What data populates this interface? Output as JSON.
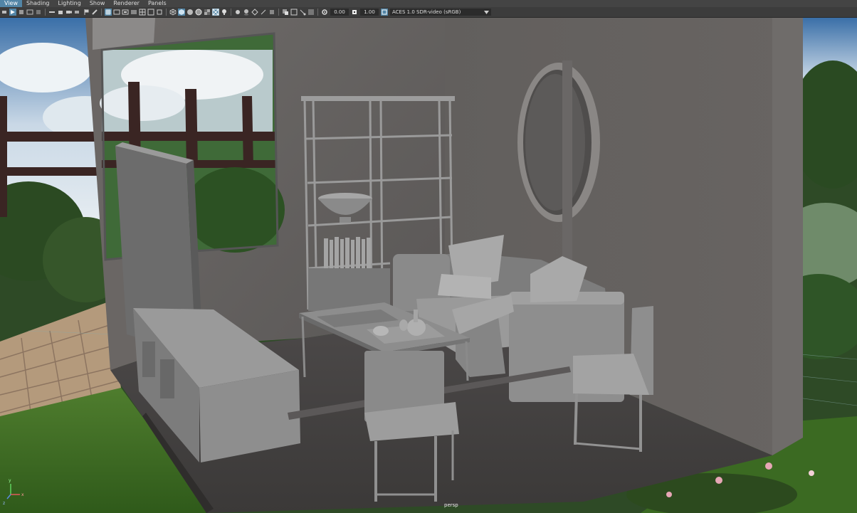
{
  "menu": {
    "items": [
      "View",
      "Shading",
      "Lighting",
      "Show",
      "Renderer",
      "Panels"
    ],
    "active": 0
  },
  "toolbar": {
    "exposure_value": "0.00",
    "gamma_value": "1.00",
    "color_management": "ACES 1.0 SDR-video (sRGB)"
  },
  "viewport": {
    "camera_label": "persp",
    "axis_x": "x",
    "axis_y": "y",
    "axis_z": "z"
  },
  "colors": {
    "active_highlight": "#5285a6",
    "ui_background": "#444444"
  }
}
